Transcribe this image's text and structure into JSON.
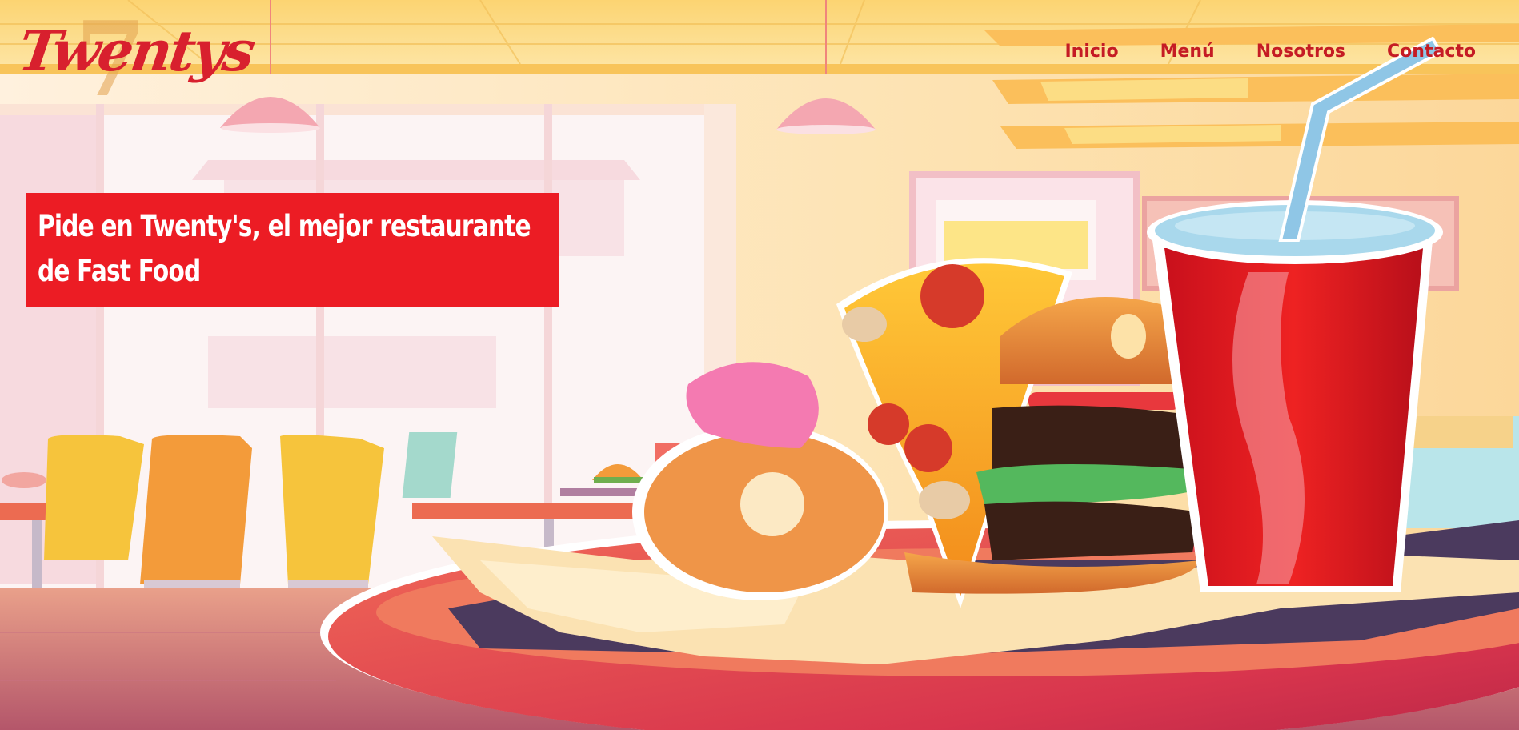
{
  "page": {
    "background_description_colors": {
      "wall": "#fde7b8",
      "ceiling": "#fcd472",
      "accent": "#ec1c24"
    }
  },
  "brand": {
    "logo_text": "Twentys",
    "logo_mark": "7"
  },
  "nav": {
    "items": [
      {
        "label": "Inicio"
      },
      {
        "label": "Menú"
      },
      {
        "label": "Nosotros"
      },
      {
        "label": "Contacto"
      }
    ],
    "color": "#c51b24"
  },
  "hero": {
    "line1": "Pide en Twenty's, el mejor restaurante",
    "line2": "de Fast Food",
    "box_color": "#ec1c24"
  }
}
